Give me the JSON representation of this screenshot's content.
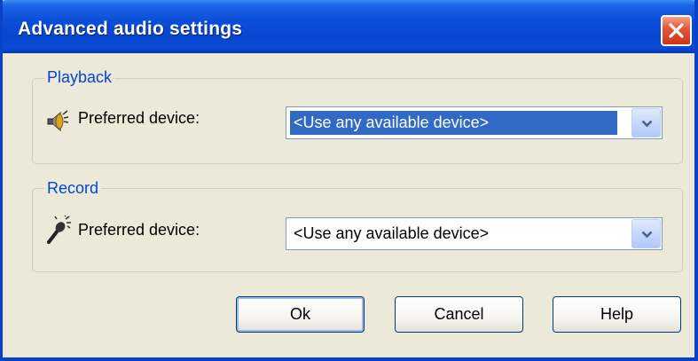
{
  "window": {
    "title": "Advanced audio settings",
    "close_icon": "close-icon"
  },
  "playback": {
    "group_label": "Playback",
    "icon": "speaker-icon",
    "preferred_label": "Preferred device:",
    "device_value": "<Use any available device>",
    "selected": true
  },
  "record": {
    "group_label": "Record",
    "icon": "microphone-icon",
    "preferred_label": "Preferred device:",
    "device_value": "<Use any available device>",
    "selected": false
  },
  "buttons": {
    "ok": "Ok",
    "cancel": "Cancel",
    "help": "Help"
  },
  "colors": {
    "titlebar": "#0a4ed8",
    "group_label": "#0046d5",
    "selection": "#316ac5",
    "close_button": "#e35a3c",
    "dialog_bg": "#ece9d8"
  }
}
